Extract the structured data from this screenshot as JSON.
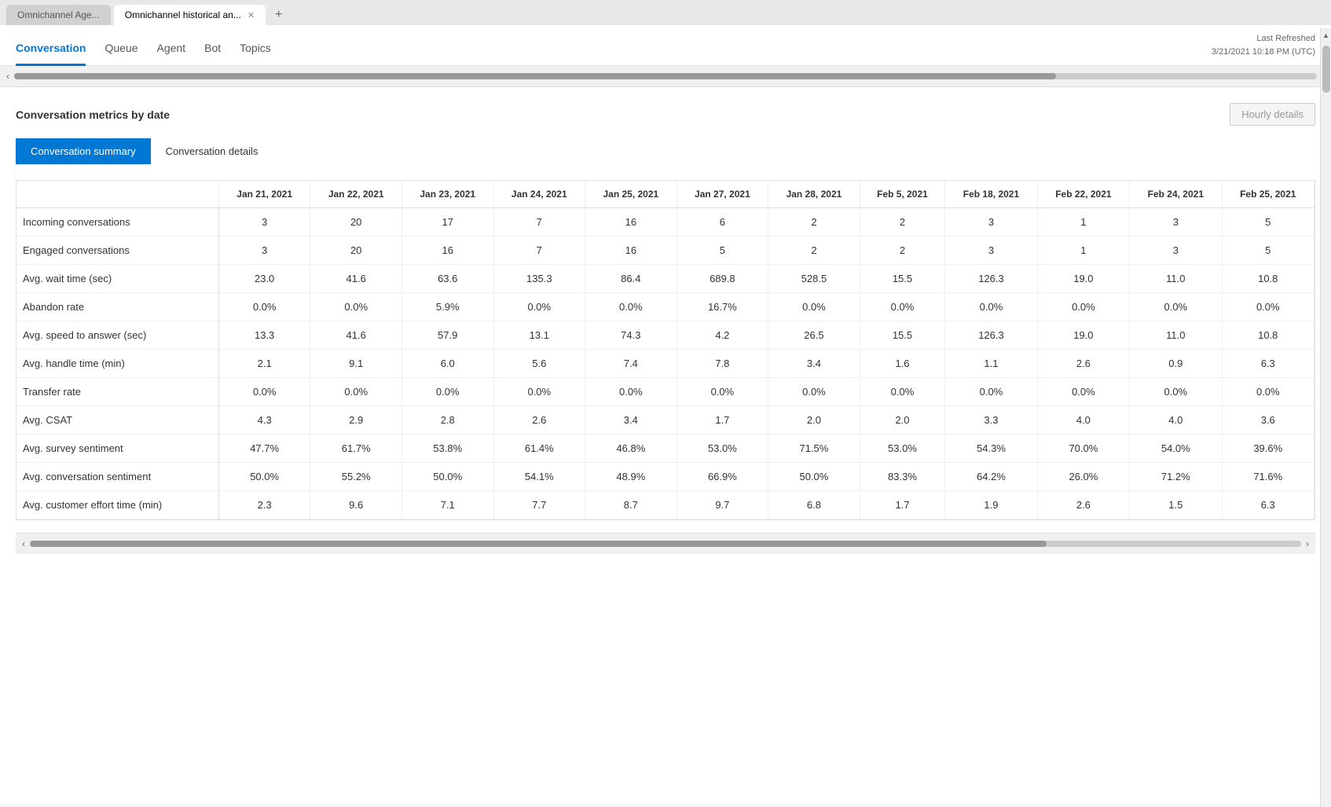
{
  "browser": {
    "tabs": [
      {
        "id": "tab1",
        "label": "Omnichannel Age...",
        "active": false
      },
      {
        "id": "tab2",
        "label": "Omnichannel historical an...",
        "active": true
      }
    ],
    "add_tab_label": "+"
  },
  "nav": {
    "tabs": [
      {
        "id": "conversation",
        "label": "Conversation",
        "active": true
      },
      {
        "id": "queue",
        "label": "Queue",
        "active": false
      },
      {
        "id": "agent",
        "label": "Agent",
        "active": false
      },
      {
        "id": "bot",
        "label": "Bot",
        "active": false
      },
      {
        "id": "topics",
        "label": "Topics",
        "active": false
      }
    ],
    "last_refreshed_label": "Last Refreshed",
    "last_refreshed_value": "3/21/2021 10:18 PM (UTC)"
  },
  "section": {
    "title": "Conversation metrics by date",
    "hourly_button": "Hourly details"
  },
  "sub_tabs": [
    {
      "id": "summary",
      "label": "Conversation summary",
      "active": true
    },
    {
      "id": "details",
      "label": "Conversation details",
      "active": false
    }
  ],
  "table": {
    "columns": [
      "",
      "Jan 21, 2021",
      "Jan 22, 2021",
      "Jan 23, 2021",
      "Jan 24, 2021",
      "Jan 25, 2021",
      "Jan 27, 2021",
      "Jan 28, 2021",
      "Feb 5, 2021",
      "Feb 18, 2021",
      "Feb 22, 2021",
      "Feb 24, 2021",
      "Feb 25, 2021"
    ],
    "rows": [
      {
        "label": "Incoming conversations",
        "values": [
          "3",
          "20",
          "17",
          "7",
          "16",
          "6",
          "2",
          "2",
          "3",
          "1",
          "3",
          "5"
        ]
      },
      {
        "label": "Engaged conversations",
        "values": [
          "3",
          "20",
          "16",
          "7",
          "16",
          "5",
          "2",
          "2",
          "3",
          "1",
          "3",
          "5"
        ]
      },
      {
        "label": "Avg. wait time (sec)",
        "values": [
          "23.0",
          "41.6",
          "63.6",
          "135.3",
          "86.4",
          "689.8",
          "528.5",
          "15.5",
          "126.3",
          "19.0",
          "11.0",
          "10.8"
        ]
      },
      {
        "label": "Abandon rate",
        "values": [
          "0.0%",
          "0.0%",
          "5.9%",
          "0.0%",
          "0.0%",
          "16.7%",
          "0.0%",
          "0.0%",
          "0.0%",
          "0.0%",
          "0.0%",
          "0.0%"
        ]
      },
      {
        "label": "Avg. speed to answer (sec)",
        "values": [
          "13.3",
          "41.6",
          "57.9",
          "13.1",
          "74.3",
          "4.2",
          "26.5",
          "15.5",
          "126.3",
          "19.0",
          "11.0",
          "10.8"
        ]
      },
      {
        "label": "Avg. handle time (min)",
        "values": [
          "2.1",
          "9.1",
          "6.0",
          "5.6",
          "7.4",
          "7.8",
          "3.4",
          "1.6",
          "1.1",
          "2.6",
          "0.9",
          "6.3"
        ]
      },
      {
        "label": "Transfer rate",
        "values": [
          "0.0%",
          "0.0%",
          "0.0%",
          "0.0%",
          "0.0%",
          "0.0%",
          "0.0%",
          "0.0%",
          "0.0%",
          "0.0%",
          "0.0%",
          "0.0%"
        ]
      },
      {
        "label": "Avg. CSAT",
        "values": [
          "4.3",
          "2.9",
          "2.8",
          "2.6",
          "3.4",
          "1.7",
          "2.0",
          "2.0",
          "3.3",
          "4.0",
          "4.0",
          "3.6"
        ]
      },
      {
        "label": "Avg. survey sentiment",
        "values": [
          "47.7%",
          "61.7%",
          "53.8%",
          "61.4%",
          "46.8%",
          "53.0%",
          "71.5%",
          "53.0%",
          "54.3%",
          "70.0%",
          "54.0%",
          "39.6%"
        ]
      },
      {
        "label": "Avg. conversation sentiment",
        "values": [
          "50.0%",
          "55.2%",
          "50.0%",
          "54.1%",
          "48.9%",
          "66.9%",
          "50.0%",
          "83.3%",
          "64.2%",
          "26.0%",
          "71.2%",
          "71.6%"
        ]
      },
      {
        "label": "Avg. customer effort time (min)",
        "values": [
          "2.3",
          "9.6",
          "7.1",
          "7.7",
          "8.7",
          "9.7",
          "6.8",
          "1.7",
          "1.9",
          "2.6",
          "1.5",
          "6.3"
        ]
      }
    ]
  }
}
